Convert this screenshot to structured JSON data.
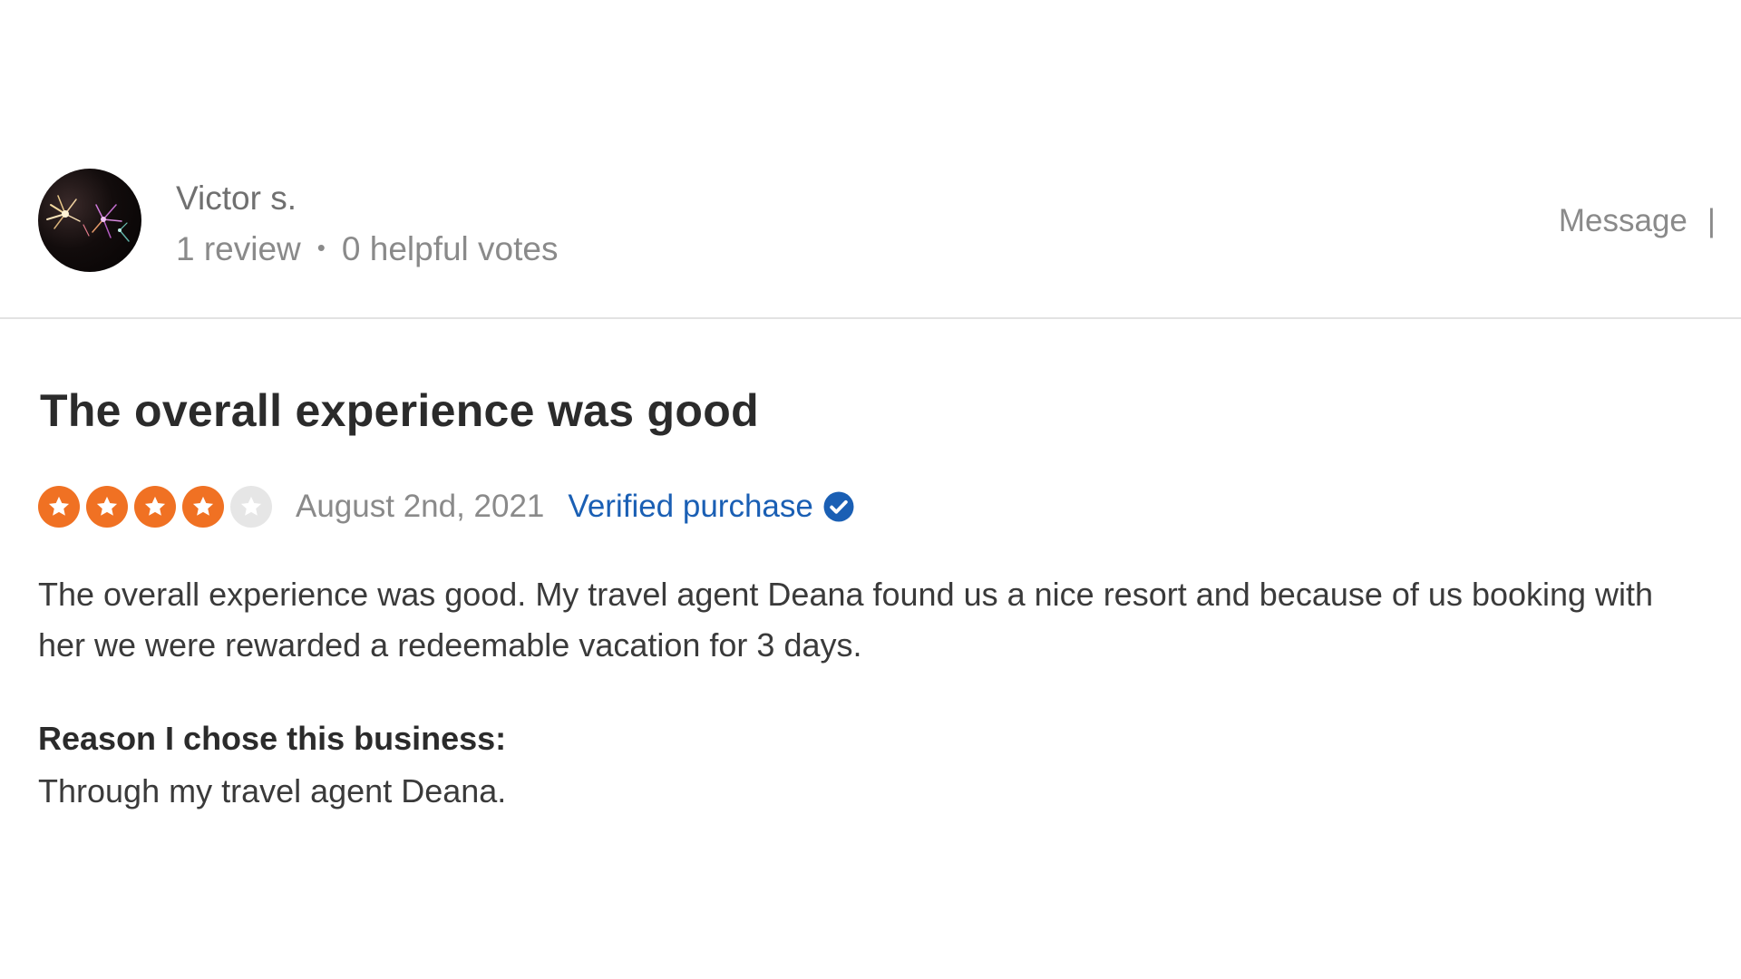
{
  "reviewer": {
    "name": "Victor s.",
    "review_count": "1 review",
    "separator": "•",
    "helpful_votes": "0 helpful votes",
    "avatar_icon": "fireworks-avatar-icon"
  },
  "actions": {
    "message_label": "Message",
    "message_separator": "|"
  },
  "review": {
    "title": "The overall experience was good",
    "rating": 4,
    "rating_max": 5,
    "date": "August 2nd, 2021",
    "verified_label": "Verified purchase",
    "verified_icon": "check-circle-icon",
    "body": "The overall experience was good. My travel agent Deana found us a nice resort and because of us booking with her we were rewarded a redeemable vacation for 3 days.",
    "reason_label": "Reason I chose this business:",
    "reason_text": "Through my travel agent Deana."
  },
  "colors": {
    "star_filled": "#f07123",
    "star_empty": "#e6e6e6",
    "verified_blue": "#1a5fb4"
  }
}
